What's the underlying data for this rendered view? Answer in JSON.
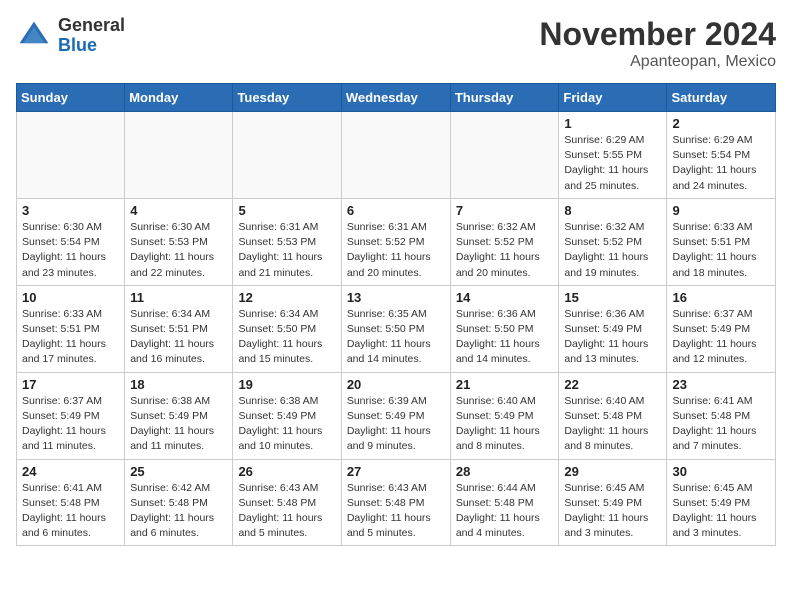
{
  "header": {
    "logo_general": "General",
    "logo_blue": "Blue",
    "month_title": "November 2024",
    "location": "Apanteopan, Mexico"
  },
  "days_of_week": [
    "Sunday",
    "Monday",
    "Tuesday",
    "Wednesday",
    "Thursday",
    "Friday",
    "Saturday"
  ],
  "weeks": [
    [
      {
        "day": "",
        "info": ""
      },
      {
        "day": "",
        "info": ""
      },
      {
        "day": "",
        "info": ""
      },
      {
        "day": "",
        "info": ""
      },
      {
        "day": "",
        "info": ""
      },
      {
        "day": "1",
        "info": "Sunrise: 6:29 AM\nSunset: 5:55 PM\nDaylight: 11 hours and 25 minutes."
      },
      {
        "day": "2",
        "info": "Sunrise: 6:29 AM\nSunset: 5:54 PM\nDaylight: 11 hours and 24 minutes."
      }
    ],
    [
      {
        "day": "3",
        "info": "Sunrise: 6:30 AM\nSunset: 5:54 PM\nDaylight: 11 hours and 23 minutes."
      },
      {
        "day": "4",
        "info": "Sunrise: 6:30 AM\nSunset: 5:53 PM\nDaylight: 11 hours and 22 minutes."
      },
      {
        "day": "5",
        "info": "Sunrise: 6:31 AM\nSunset: 5:53 PM\nDaylight: 11 hours and 21 minutes."
      },
      {
        "day": "6",
        "info": "Sunrise: 6:31 AM\nSunset: 5:52 PM\nDaylight: 11 hours and 20 minutes."
      },
      {
        "day": "7",
        "info": "Sunrise: 6:32 AM\nSunset: 5:52 PM\nDaylight: 11 hours and 20 minutes."
      },
      {
        "day": "8",
        "info": "Sunrise: 6:32 AM\nSunset: 5:52 PM\nDaylight: 11 hours and 19 minutes."
      },
      {
        "day": "9",
        "info": "Sunrise: 6:33 AM\nSunset: 5:51 PM\nDaylight: 11 hours and 18 minutes."
      }
    ],
    [
      {
        "day": "10",
        "info": "Sunrise: 6:33 AM\nSunset: 5:51 PM\nDaylight: 11 hours and 17 minutes."
      },
      {
        "day": "11",
        "info": "Sunrise: 6:34 AM\nSunset: 5:51 PM\nDaylight: 11 hours and 16 minutes."
      },
      {
        "day": "12",
        "info": "Sunrise: 6:34 AM\nSunset: 5:50 PM\nDaylight: 11 hours and 15 minutes."
      },
      {
        "day": "13",
        "info": "Sunrise: 6:35 AM\nSunset: 5:50 PM\nDaylight: 11 hours and 14 minutes."
      },
      {
        "day": "14",
        "info": "Sunrise: 6:36 AM\nSunset: 5:50 PM\nDaylight: 11 hours and 14 minutes."
      },
      {
        "day": "15",
        "info": "Sunrise: 6:36 AM\nSunset: 5:49 PM\nDaylight: 11 hours and 13 minutes."
      },
      {
        "day": "16",
        "info": "Sunrise: 6:37 AM\nSunset: 5:49 PM\nDaylight: 11 hours and 12 minutes."
      }
    ],
    [
      {
        "day": "17",
        "info": "Sunrise: 6:37 AM\nSunset: 5:49 PM\nDaylight: 11 hours and 11 minutes."
      },
      {
        "day": "18",
        "info": "Sunrise: 6:38 AM\nSunset: 5:49 PM\nDaylight: 11 hours and 11 minutes."
      },
      {
        "day": "19",
        "info": "Sunrise: 6:38 AM\nSunset: 5:49 PM\nDaylight: 11 hours and 10 minutes."
      },
      {
        "day": "20",
        "info": "Sunrise: 6:39 AM\nSunset: 5:49 PM\nDaylight: 11 hours and 9 minutes."
      },
      {
        "day": "21",
        "info": "Sunrise: 6:40 AM\nSunset: 5:49 PM\nDaylight: 11 hours and 8 minutes."
      },
      {
        "day": "22",
        "info": "Sunrise: 6:40 AM\nSunset: 5:48 PM\nDaylight: 11 hours and 8 minutes."
      },
      {
        "day": "23",
        "info": "Sunrise: 6:41 AM\nSunset: 5:48 PM\nDaylight: 11 hours and 7 minutes."
      }
    ],
    [
      {
        "day": "24",
        "info": "Sunrise: 6:41 AM\nSunset: 5:48 PM\nDaylight: 11 hours and 6 minutes."
      },
      {
        "day": "25",
        "info": "Sunrise: 6:42 AM\nSunset: 5:48 PM\nDaylight: 11 hours and 6 minutes."
      },
      {
        "day": "26",
        "info": "Sunrise: 6:43 AM\nSunset: 5:48 PM\nDaylight: 11 hours and 5 minutes."
      },
      {
        "day": "27",
        "info": "Sunrise: 6:43 AM\nSunset: 5:48 PM\nDaylight: 11 hours and 5 minutes."
      },
      {
        "day": "28",
        "info": "Sunrise: 6:44 AM\nSunset: 5:48 PM\nDaylight: 11 hours and 4 minutes."
      },
      {
        "day": "29",
        "info": "Sunrise: 6:45 AM\nSunset: 5:49 PM\nDaylight: 11 hours and 3 minutes."
      },
      {
        "day": "30",
        "info": "Sunrise: 6:45 AM\nSunset: 5:49 PM\nDaylight: 11 hours and 3 minutes."
      }
    ]
  ]
}
